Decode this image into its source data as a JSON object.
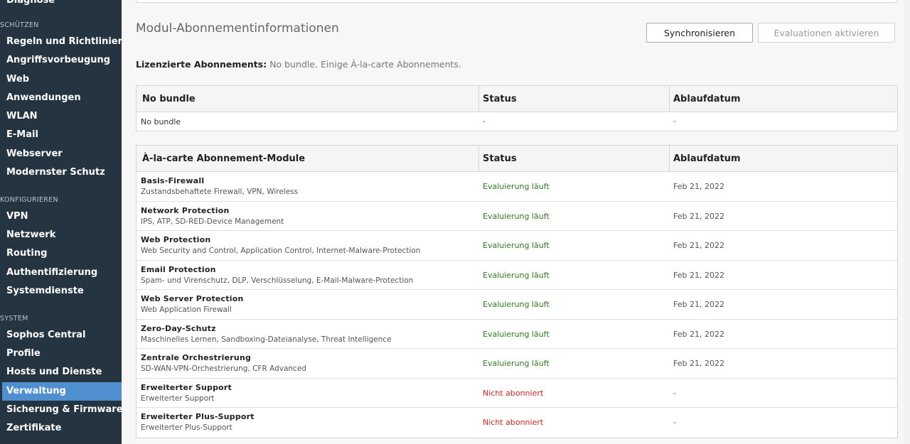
{
  "sidebar": {
    "top_item": "Diagnose",
    "sections": [
      {
        "label": "SCHÜTZEN",
        "items": [
          "Regeln und Richtlinien",
          "Angriffsvorbeugung",
          "Web",
          "Anwendungen",
          "WLAN",
          "E-Mail",
          "Webserver",
          "Modernster Schutz"
        ]
      },
      {
        "label": "KONFIGURIEREN",
        "items": [
          "VPN",
          "Netzwerk",
          "Routing",
          "Authentifizierung",
          "Systemdienste"
        ]
      },
      {
        "label": "SYSTEM",
        "items": [
          "Sophos Central",
          "Profile",
          "Hosts und Dienste",
          "Verwaltung",
          "Sicherung & Firmware",
          "Zertifikate"
        ]
      }
    ],
    "active_item": "Verwaltung"
  },
  "main": {
    "title": "Modul-Abonnementinformationen",
    "buttons": {
      "sync": "Synchronisieren",
      "evaluate": "Evaluationen aktivieren"
    },
    "licensed": {
      "label": "Lizenzierte Abonnements:",
      "value": "No bundle. Einige À-la-carte Abonnements."
    },
    "bundle_table": {
      "headers": [
        "No bundle",
        "Status",
        "Ablaufdatum"
      ],
      "rows": [
        {
          "name": "No bundle",
          "status": "-",
          "date": "-"
        }
      ]
    },
    "modules_table": {
      "headers": [
        "À-la-carte Abonnement-Module",
        "Status",
        "Ablaufdatum"
      ],
      "rows": [
        {
          "name": "Basis-Firewall",
          "desc": "Zustandsbehaftete Firewall, VPN, Wireless",
          "status": "Evaluierung läuft",
          "date": "Feb 21, 2022"
        },
        {
          "name": "Network Protection",
          "desc": "IPS, ATP, SD-RED-Device Management",
          "status": "Evaluierung läuft",
          "date": "Feb 21, 2022"
        },
        {
          "name": "Web Protection",
          "desc": "Web Security and Control, Application Control, Internet-Malware-Protection",
          "status": "Evaluierung läuft",
          "date": "Feb 21, 2022"
        },
        {
          "name": "Email Protection",
          "desc": "Spam- und Virenschutz, DLP, Verschlüsselung, E-Mail-Malware-Protection",
          "status": "Evaluierung läuft",
          "date": "Feb 21, 2022"
        },
        {
          "name": "Web Server Protection",
          "desc": "Web Application Firewall",
          "status": "Evaluierung läuft",
          "date": "Feb 21, 2022"
        },
        {
          "name": "Zero-Day-Schutz",
          "desc": "Maschinelles Lernen, Sandboxing-Dateianalyse, Threat Intelligence",
          "status": "Evaluierung läuft",
          "date": "Feb 21, 2022"
        },
        {
          "name": "Zentrale Orchestrierung",
          "desc": "SD-WAN-VPN-Orchestrierung, CFR Advanced",
          "status": "Evaluierung läuft",
          "date": "Feb 21, 2022"
        },
        {
          "name": "Erweiterter Support",
          "desc": "Erweiterter Support",
          "status": "Nicht abonniert",
          "date": "-"
        },
        {
          "name": "Erweiterter Plus-Support",
          "desc": "Erweiterter Plus-Support",
          "status": "Nicht abonniert",
          "date": "-"
        }
      ]
    }
  },
  "colors": {
    "sidebar_bg": "#243441",
    "active_bg": "#4f8fd0",
    "status_ok": "#2e7d1e",
    "status_bad": "#d9261c"
  }
}
